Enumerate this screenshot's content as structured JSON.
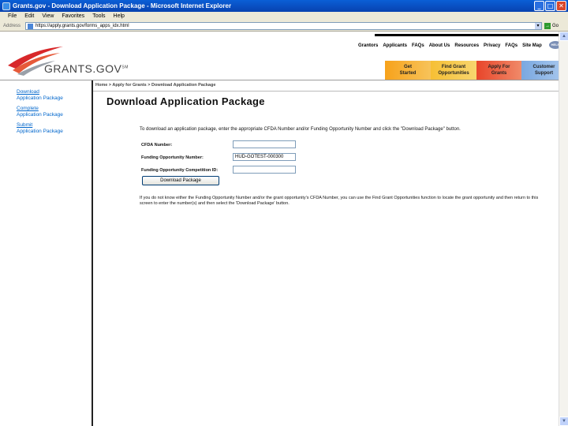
{
  "window": {
    "title": "Grants.gov - Download Application Package - Microsoft Internet Explorer",
    "minimize": "_",
    "maximize": "□",
    "close": "✕"
  },
  "menu": [
    "File",
    "Edit",
    "View",
    "Favorites",
    "Tools",
    "Help"
  ],
  "address": {
    "label": "Address",
    "url": "https://apply.grants.gov/forms_apps_idx.html",
    "go_label": "Go"
  },
  "header": {
    "logo_text": "GRANTS.GOV",
    "logo_sup": "SM",
    "top_links": [
      "Grantors",
      "Applicants",
      "FAQs",
      "About Us",
      "Resources",
      "Privacy",
      "FAQs",
      "Site Map"
    ],
    "help_badge": "HELP",
    "tabs": [
      {
        "line1": "Get",
        "line2": "Started"
      },
      {
        "line1": "Find Grant",
        "line2": "Opportunities"
      },
      {
        "line1": "Apply For",
        "line2": "Grants"
      },
      {
        "line1": "Customer",
        "line2": "Support"
      }
    ]
  },
  "sidebar": {
    "items": [
      {
        "link": "Download",
        "sub": "Application Package"
      },
      {
        "link": "Complete",
        "sub": "Application Package"
      },
      {
        "link": "Submit",
        "sub": "Application Package"
      }
    ]
  },
  "breadcrumb": "Home > Apply for Grants > Download Application Package",
  "main": {
    "title": "Download Application Package",
    "instructions": "To download an application package, enter the appropriate CFDA Number and/or Funding Opportunity Number and click the \"Download Package\" button.",
    "form": {
      "cfda_label": "CFDA Number:",
      "cfda_value": "",
      "fon_label": "Funding Opportunity Number:",
      "fon_value": "HUD-GOTEST-000300",
      "comp_label": "Funding Opportunity Competition ID:",
      "comp_value": "",
      "button_label": "Download Package"
    },
    "note": "If you do not know either the Funding Opportunity Number and/or the grant opportunity's CFDA Number, you can use the Find Grant Opportunities function to locate the grant opportunity and then return to this screen to enter the number(s) and then select the 'Download Package' button."
  }
}
